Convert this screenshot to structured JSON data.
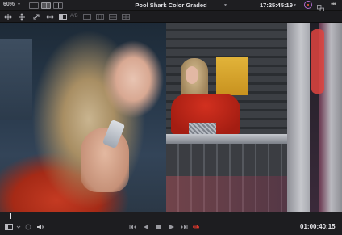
{
  "topbar": {
    "zoom_label": "60%",
    "clip_title": "Pool Shark Color Graded",
    "timecode": "17:25:45:19",
    "icons": [
      "layout-single-icon",
      "layout-split-icon",
      "layout-video-icon",
      "color-fx-icon",
      "compare-icon",
      "more-icon"
    ]
  },
  "toolbar2": {
    "tools": [
      "wipe-horizontal-icon",
      "wipe-vertical-icon",
      "wipe-diagonal-icon",
      "wipe-center-icon",
      "split-screen-icon",
      "ab-mode-icon",
      "view-mode-1-icon",
      "view-mode-2-icon",
      "view-mode-3-icon",
      "view-mode-4-icon"
    ],
    "ab_label": "A/B"
  },
  "viewer": {
    "split": "vertical"
  },
  "scrub": {
    "position_fraction": 0.02
  },
  "transport": {
    "end_timecode": "01:00:40:15",
    "controls": [
      "first-frame-icon",
      "reverse-play-icon",
      "stop-icon",
      "play-icon",
      "last-frame-icon",
      "loop-icon"
    ],
    "accent_loop": "#e0382c"
  }
}
